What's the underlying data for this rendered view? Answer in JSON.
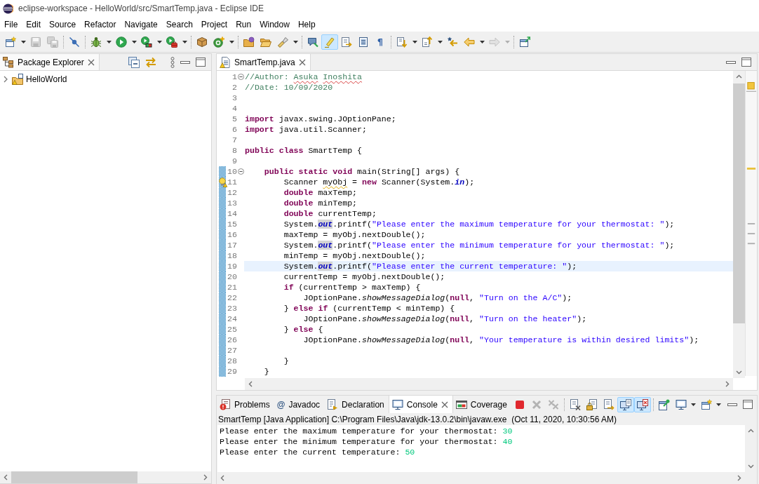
{
  "window": {
    "title": "eclipse-workspace - HelloWorld/src/SmartTemp.java - Eclipse IDE"
  },
  "menu": [
    "File",
    "Edit",
    "Source",
    "Refactor",
    "Navigate",
    "Search",
    "Project",
    "Run",
    "Window",
    "Help"
  ],
  "toolbar": [
    [
      {
        "disabled": false,
        "on": false,
        "dropdown": true
      },
      {
        "disabled": true,
        "on": false,
        "dropdown": false
      },
      {
        "disabled": true,
        "on": false,
        "dropdown": false
      }
    ],
    [
      {
        "disabled": false,
        "on": false,
        "dropdown": false
      }
    ],
    [
      {
        "disabled": false,
        "on": false,
        "dropdown": true
      },
      {
        "disabled": false,
        "on": false,
        "dropdown": true
      },
      {
        "disabled": false,
        "on": false,
        "dropdown": true
      },
      {
        "disabled": false,
        "on": false,
        "dropdown": true
      }
    ],
    [
      {
        "disabled": false,
        "on": false,
        "dropdown": false
      },
      {
        "disabled": false,
        "on": false,
        "dropdown": true
      }
    ],
    [
      {
        "disabled": false,
        "on": false,
        "dropdown": false
      },
      {
        "disabled": false,
        "on": false,
        "dropdown": false
      },
      {
        "disabled": false,
        "on": false,
        "dropdown": true
      }
    ],
    [
      {
        "disabled": false,
        "on": false,
        "dropdown": false
      },
      {
        "disabled": false,
        "on": true,
        "dropdown": false
      },
      {
        "disabled": false,
        "on": false,
        "dropdown": false
      },
      {
        "disabled": false,
        "on": false,
        "dropdown": false
      },
      {
        "glyph": "¶",
        "disabled": false,
        "on": false,
        "dropdown": false
      }
    ],
    [
      {
        "disabled": false,
        "on": false,
        "dropdown": true
      },
      {
        "disabled": false,
        "on": false,
        "dropdown": true
      },
      {
        "disabled": false,
        "on": false,
        "dropdown": false
      },
      {
        "disabled": false,
        "on": false,
        "dropdown": true
      },
      {
        "disabled": true,
        "on": false,
        "dropdown": true
      }
    ],
    [
      {
        "disabled": false,
        "on": false,
        "dropdown": false
      }
    ]
  ],
  "package_explorer": {
    "tab": {
      "label": "Package Explorer",
      "selected": true
    },
    "tree": [
      {
        "label": "HelloWorld",
        "expanded": false
      }
    ]
  },
  "editor": {
    "tab": {
      "label": "SmartTemp.java",
      "selected": true
    },
    "lines": [
      {
        "number": "1",
        "changed": false,
        "current": false,
        "fold": true,
        "warning": false,
        "tokens": [
          {
            "kind": "comment",
            "text": "//Author:"
          },
          {
            "kind": "misspelled",
            "text": " Asuka"
          },
          {
            "kind": "misspelled",
            "text": " Inoshita"
          }
        ]
      },
      {
        "number": "2",
        "changed": false,
        "current": false,
        "fold": false,
        "warning": false,
        "tokens": [
          {
            "kind": "comment",
            "text": "//Date: 10/09/2020"
          }
        ]
      },
      {
        "number": "3",
        "changed": false,
        "current": false,
        "fold": false,
        "warning": false
      },
      {
        "number": "4",
        "changed": false,
        "current": false,
        "fold": false,
        "warning": false
      },
      {
        "number": "5",
        "changed": false,
        "current": false,
        "fold": false,
        "warning": false,
        "tokens": [
          {
            "kind": "keyword",
            "text": "import"
          },
          {
            "kind": "plain",
            "text": " javax.swing.JOptionPane;"
          }
        ]
      },
      {
        "number": "6",
        "changed": false,
        "current": false,
        "fold": false,
        "warning": false,
        "tokens": [
          {
            "kind": "keyword",
            "text": "import"
          },
          {
            "kind": "plain",
            "text": " java.util.Scanner;"
          }
        ]
      },
      {
        "number": "7",
        "changed": false,
        "current": false,
        "fold": false,
        "warning": false
      },
      {
        "number": "8",
        "changed": false,
        "current": false,
        "fold": false,
        "warning": false,
        "tokens": [
          {
            "kind": "keyword",
            "text": "public"
          },
          {
            "kind": "keyword",
            "text": " class"
          },
          {
            "kind": "plain",
            "text": " SmartTemp {"
          }
        ]
      },
      {
        "number": "9",
        "changed": false,
        "current": false,
        "fold": false,
        "warning": false
      },
      {
        "number": "10",
        "changed": true,
        "current": false,
        "fold": true,
        "warning": false,
        "tokens": [
          {
            "kind": "keyword",
            "text": "    public"
          },
          {
            "kind": "keyword",
            "text": " static"
          },
          {
            "kind": "keyword",
            "text": " void"
          },
          {
            "kind": "plain",
            "text": " main(String[] args) {"
          }
        ]
      },
      {
        "number": "11",
        "changed": true,
        "current": false,
        "fold": false,
        "warning": true,
        "tokens": [
          {
            "kind": "plain",
            "text": "        Scanner"
          },
          {
            "kind": "warning",
            "text": " myObj"
          },
          {
            "kind": "plain",
            "text": " ="
          },
          {
            "kind": "keyword",
            "text": " new"
          },
          {
            "kind": "plain",
            "text": " Scanner(System."
          },
          {
            "kind": "field",
            "text": "in"
          },
          {
            "kind": "plain",
            "text": ");"
          }
        ]
      },
      {
        "number": "12",
        "changed": true,
        "current": false,
        "fold": false,
        "warning": false,
        "tokens": [
          {
            "kind": "keyword",
            "text": "        double"
          },
          {
            "kind": "plain",
            "text": " maxTemp;"
          }
        ]
      },
      {
        "number": "13",
        "changed": true,
        "current": false,
        "fold": false,
        "warning": false,
        "tokens": [
          {
            "kind": "keyword",
            "text": "        double"
          },
          {
            "kind": "plain",
            "text": " minTemp;"
          }
        ]
      },
      {
        "number": "14",
        "changed": true,
        "current": false,
        "fold": false,
        "warning": false,
        "tokens": [
          {
            "kind": "keyword",
            "text": "        double"
          },
          {
            "kind": "plain",
            "text": " currentTemp;"
          }
        ]
      },
      {
        "number": "15",
        "changed": true,
        "current": false,
        "fold": false,
        "warning": false,
        "tokens": [
          {
            "kind": "plain",
            "text": "        System."
          },
          {
            "kind": "occurrence",
            "text": "out"
          },
          {
            "kind": "plain",
            "text": ".printf("
          },
          {
            "kind": "string",
            "text": "\"Please enter the maximum temperature for your thermostat: \""
          },
          {
            "kind": "plain",
            "text": ");"
          }
        ]
      },
      {
        "number": "16",
        "changed": true,
        "current": false,
        "fold": false,
        "warning": false,
        "tokens": [
          {
            "kind": "plain",
            "text": "        maxTemp = myObj.nextDouble();"
          }
        ]
      },
      {
        "number": "17",
        "changed": true,
        "current": false,
        "fold": false,
        "warning": false,
        "tokens": [
          {
            "kind": "plain",
            "text": "        System."
          },
          {
            "kind": "occurrence",
            "text": "out"
          },
          {
            "kind": "plain",
            "text": ".printf("
          },
          {
            "kind": "string",
            "text": "\"Please enter the minimum temperature for your thermostat: \""
          },
          {
            "kind": "plain",
            "text": ");"
          }
        ]
      },
      {
        "number": "18",
        "changed": true,
        "current": false,
        "fold": false,
        "warning": false,
        "tokens": [
          {
            "kind": "plain",
            "text": "        minTemp = myObj.nextDouble();"
          }
        ]
      },
      {
        "number": "19",
        "changed": true,
        "current": true,
        "fold": false,
        "warning": false,
        "tokens": [
          {
            "kind": "plain",
            "text": "        System."
          },
          {
            "kind": "occurrence",
            "text": "out"
          },
          {
            "kind": "plain",
            "text": ".printf("
          },
          {
            "kind": "string",
            "text": "\"Please enter the current temperature: \""
          },
          {
            "kind": "plain",
            "text": ");"
          }
        ]
      },
      {
        "number": "20",
        "changed": true,
        "current": false,
        "fold": false,
        "warning": false,
        "tokens": [
          {
            "kind": "plain",
            "text": "        currentTemp = myObj.nextDouble();"
          }
        ]
      },
      {
        "number": "21",
        "changed": true,
        "current": false,
        "fold": false,
        "warning": false,
        "tokens": [
          {
            "kind": "keyword",
            "text": "        if"
          },
          {
            "kind": "plain",
            "text": " (currentTemp > maxTemp) {"
          }
        ]
      },
      {
        "number": "22",
        "changed": true,
        "current": false,
        "fold": false,
        "warning": false,
        "tokens": [
          {
            "kind": "plain",
            "text": "            JOptionPane."
          },
          {
            "kind": "static",
            "text": "showMessageDialog"
          },
          {
            "kind": "plain",
            "text": "("
          },
          {
            "kind": "keyword",
            "text": "null"
          },
          {
            "kind": "plain",
            "text": ","
          },
          {
            "kind": "string",
            "text": " \"Turn on the A/C\""
          },
          {
            "kind": "plain",
            "text": ");"
          }
        ]
      },
      {
        "number": "23",
        "changed": true,
        "current": false,
        "fold": false,
        "warning": false,
        "tokens": [
          {
            "kind": "plain",
            "text": "        }"
          },
          {
            "kind": "keyword",
            "text": " else"
          },
          {
            "kind": "keyword",
            "text": " if"
          },
          {
            "kind": "plain",
            "text": " (currentTemp < minTemp) {"
          }
        ]
      },
      {
        "number": "24",
        "changed": true,
        "current": false,
        "fold": false,
        "warning": false,
        "tokens": [
          {
            "kind": "plain",
            "text": "            JOptionPane."
          },
          {
            "kind": "static",
            "text": "showMessageDialog"
          },
          {
            "kind": "plain",
            "text": "("
          },
          {
            "kind": "keyword",
            "text": "null"
          },
          {
            "kind": "plain",
            "text": ","
          },
          {
            "kind": "string",
            "text": " \"Turn on the heater\""
          },
          {
            "kind": "plain",
            "text": ");"
          }
        ]
      },
      {
        "number": "25",
        "changed": true,
        "current": false,
        "fold": false,
        "warning": false,
        "tokens": [
          {
            "kind": "plain",
            "text": "        }"
          },
          {
            "kind": "keyword",
            "text": " else"
          },
          {
            "kind": "plain",
            "text": " {"
          }
        ]
      },
      {
        "number": "26",
        "changed": true,
        "current": false,
        "fold": false,
        "warning": false,
        "tokens": [
          {
            "kind": "plain",
            "text": "            JOptionPane."
          },
          {
            "kind": "static",
            "text": "showMessageDialog"
          },
          {
            "kind": "plain",
            "text": "("
          },
          {
            "kind": "keyword",
            "text": "null"
          },
          {
            "kind": "plain",
            "text": ","
          },
          {
            "kind": "string",
            "text": " \"Your temperature is within desired limits\""
          },
          {
            "kind": "plain",
            "text": ");"
          }
        ]
      },
      {
        "number": "27",
        "changed": true,
        "current": false,
        "fold": false,
        "warning": false
      },
      {
        "number": "28",
        "changed": true,
        "current": false,
        "fold": false,
        "warning": false,
        "tokens": [
          {
            "kind": "plain",
            "text": "        }"
          }
        ]
      },
      {
        "number": "29",
        "changed": true,
        "current": false,
        "fold": false,
        "warning": false,
        "tokens": [
          {
            "kind": "plain",
            "text": "    }"
          }
        ]
      }
    ]
  },
  "console_view": {
    "tabs": [
      {
        "label": "Problems",
        "selected": false
      },
      {
        "glyph": "@",
        "label": "Javadoc",
        "selected": false
      },
      {
        "label": "Declaration",
        "selected": false
      },
      {
        "label": "Console",
        "selected": true
      },
      {
        "label": "Coverage",
        "selected": false
      }
    ],
    "toolbar": [
      [
        {
          "disabled": false,
          "on": false,
          "dropdown": false
        },
        {
          "disabled": true,
          "on": false,
          "dropdown": false
        },
        {
          "disabled": true,
          "on": false,
          "dropdown": false
        }
      ],
      [
        {
          "disabled": false,
          "on": false,
          "dropdown": false
        },
        {
          "disabled": false,
          "on": false,
          "dropdown": false
        },
        {
          "disabled": false,
          "on": false,
          "dropdown": false
        },
        {
          "disabled": false,
          "on": true,
          "dropdown": false
        },
        {
          "disabled": false,
          "on": true,
          "dropdown": false
        }
      ],
      [
        {
          "disabled": false,
          "on": false,
          "dropdown": false
        },
        {
          "disabled": false,
          "on": false,
          "dropdown": true
        },
        {
          "disabled": false,
          "on": false,
          "dropdown": true
        }
      ]
    ],
    "process": "SmartTemp [Java Application] C:\\Program Files\\Java\\jdk-13.0.2\\bin\\javaw.exe  (Oct 11, 2020, 10:30:56 AM)",
    "lines": [
      {
        "output": "Please enter the maximum temperature for your thermostat: ",
        "input": "30"
      },
      {
        "output": "Please enter the minimum temperature for your thermostat: ",
        "input": "40"
      },
      {
        "output": "Please enter the current temperature: ",
        "input": "50"
      }
    ]
  }
}
